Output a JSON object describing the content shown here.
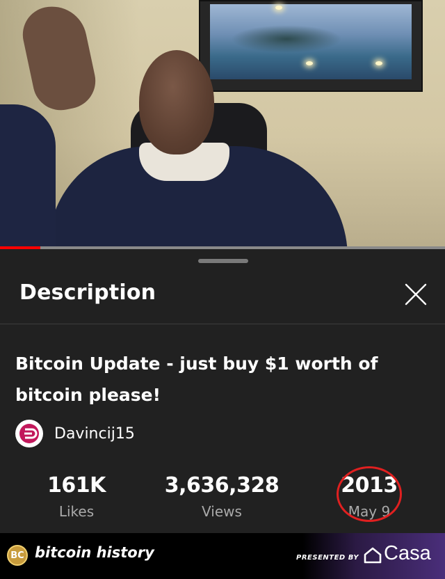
{
  "video": {
    "progress_fraction": 0.09
  },
  "sheet": {
    "title": "Description",
    "video_title": "Bitcoin Update - just buy $1 worth of bitcoin please!",
    "channel": {
      "name": "Davincij15"
    },
    "stats": [
      {
        "value": "161K",
        "label": "Likes"
      },
      {
        "value": "3,636,328",
        "label": "Views"
      },
      {
        "value": "2013",
        "label": "May 9"
      }
    ],
    "highlight_color": "#e02020"
  },
  "footer": {
    "logo_text": "BC",
    "brand": "bitcoin history",
    "presented_by": "PRESENTED BY",
    "sponsor": "Casa"
  },
  "colors": {
    "sheet_bg": "#212121",
    "progress": "#ff0000",
    "secondary_text": "#aaaaaa"
  },
  "icons": [
    "close-icon",
    "channel-avatar-icon",
    "casa-house-icon",
    "bc-logo-icon"
  ]
}
